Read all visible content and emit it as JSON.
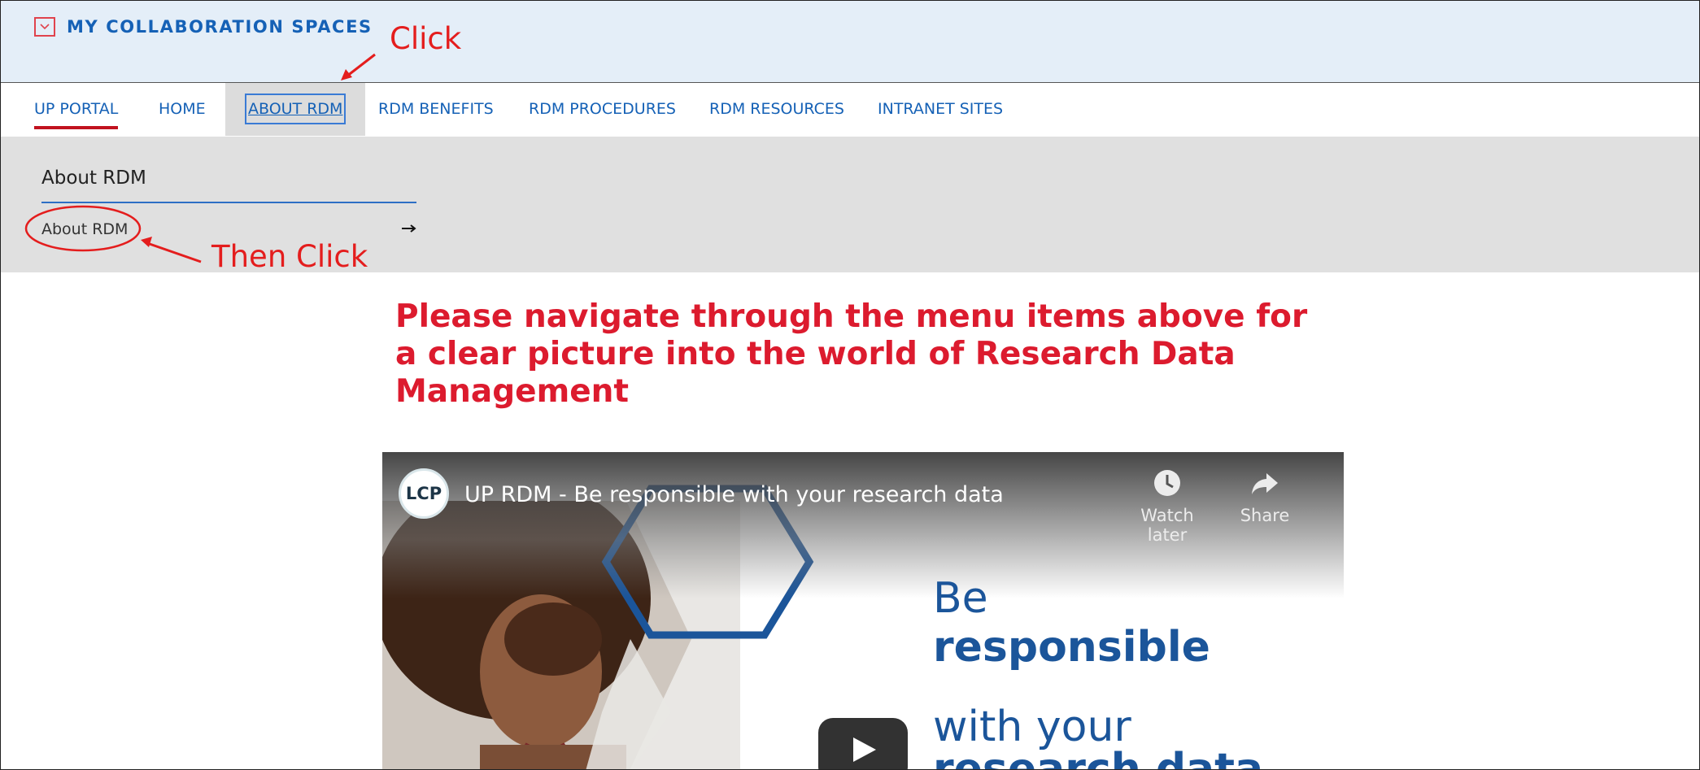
{
  "banner": {
    "title": "MY COLLABORATION SPACES"
  },
  "nav": {
    "items": [
      {
        "label": "UP PORTAL"
      },
      {
        "label": "HOME"
      },
      {
        "label": "ABOUT RDM"
      },
      {
        "label": "RDM BENEFITS"
      },
      {
        "label": "RDM PROCEDURES"
      },
      {
        "label": "RDM RESOURCES"
      },
      {
        "label": "INTRANET SITES"
      }
    ]
  },
  "submenu": {
    "heading": "About RDM",
    "link": "About RDM"
  },
  "annotations": {
    "first": "Click",
    "second": "Then Click",
    "color": "#e41d1d"
  },
  "main": {
    "heading": "Please navigate through the menu items above for a clear picture into the world of Research Data Management"
  },
  "video": {
    "channel_logo": "LCP",
    "title": "UP RDM - Be responsible with your research data",
    "watch_later": "Watch later",
    "share": "Share",
    "slide_line1": "Be",
    "slide_line2": "responsible",
    "slide_line3": "with your",
    "slide_line4": "research data"
  },
  "colors": {
    "brand_blue": "#1561b6",
    "accent_red": "#dc1b2e",
    "banner_bg": "#e4eef8"
  }
}
